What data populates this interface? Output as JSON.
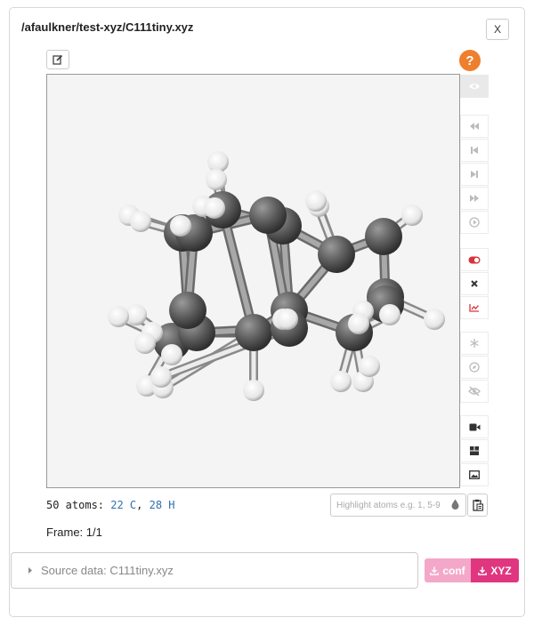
{
  "header": {
    "file_path": "/afaulkner/test-xyz/C111tiny.xyz",
    "close_label": "X"
  },
  "help": {
    "label": "?"
  },
  "atoms": {
    "prefix": "50 atoms: ",
    "c_count": "22 C",
    "sep": ", ",
    "h_count": "28 H"
  },
  "highlight": {
    "placeholder": "Highlight atoms e.g. 1, 5-9"
  },
  "frame": {
    "label": "Frame: 1/1"
  },
  "source": {
    "label": "Source data: C111tiny.xyz"
  },
  "downloads": {
    "conf_label": "conf",
    "xyz_label": "XYZ"
  },
  "colors": {
    "accent_orange": "#ee7f2d",
    "download_light": "#f3a8c9",
    "download_dark": "#e0367f",
    "atom_link": "#2d6fb1",
    "red_icon": "#d9333a"
  },
  "toolbar_icons": [
    "eye-icon",
    "first-frame-icon",
    "prev-frame-icon",
    "next-frame-icon",
    "last-frame-icon",
    "play-icon",
    "toggle-icon",
    "close-icon",
    "chart-icon",
    "snowflake-icon",
    "compass-icon",
    "eye-slash-icon",
    "video-icon",
    "cube-icon",
    "image-icon"
  ]
}
